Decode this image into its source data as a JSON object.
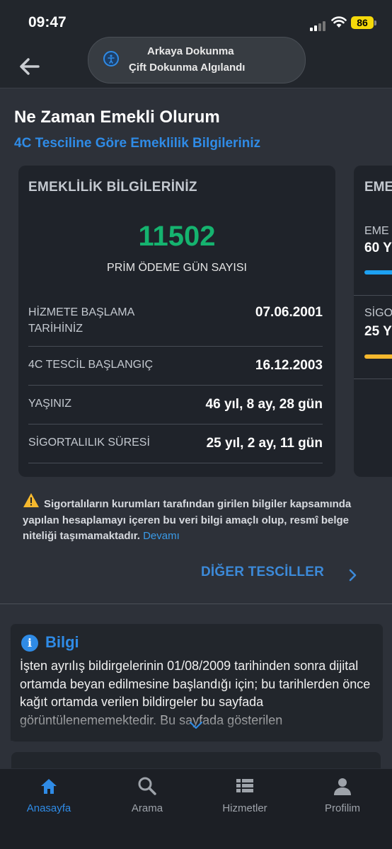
{
  "status": {
    "time": "09:47",
    "battery": "86"
  },
  "toast": {
    "line1": "Arkaya Dokunma",
    "line2": "Çift Dokunma Algılandı"
  },
  "page": {
    "title": "Ne Zaman Emekli Olurum",
    "subtitle": "4C Tesciline Göre Emeklilik Bilgileriniz"
  },
  "card": {
    "title": "EMEKLİLİK BİLGİLERİNİZ",
    "premium_days": "11502",
    "premium_days_label": "PRİM ÖDEME GÜN SAYISI",
    "rows": [
      {
        "label": "HİZMETE BAŞLAMA TARİHİNİZ",
        "value": "07.06.2001"
      },
      {
        "label": "4C TESCİL BAŞLANGIÇ",
        "value": "16.12.2003"
      },
      {
        "label": "YAŞINIZ",
        "value": "46 yıl, 8 ay, 28 gün"
      },
      {
        "label": "SİGORTALILIK SÜRESİ",
        "value": "25 yıl, 2 ay, 11 gün"
      }
    ]
  },
  "card2": {
    "title": "EME",
    "row1_label": "EME",
    "row1_value": "60 Y",
    "row2_label": "SİGO",
    "row2_value": "25 Y",
    "bar1_color": "#1da1f2",
    "bar2_color": "#f5b82e"
  },
  "warning": {
    "text": "Sigortalıların kurumları tarafından girilen bilgiler kapsamında yapılan hesaplamayı içeren bu veri bilgi amaçlı olup, resmî belge niteliği taşımamaktadır.",
    "link": "Devamı"
  },
  "other_registrations": "DİĞER TESCİLLER",
  "info": {
    "title": "Bilgi",
    "text": "İşten ayrılış bildirgelerinin 01/08/2009 tarihinden sonra dijital ortamda beyan edilmesine başlandığı için; bu tarihlerden önce kağıt ortamda verilen bildirgeler bu sayfada görüntülenememektedir. Bu sayfada gösterilen"
  },
  "tabs": [
    {
      "label": "Anasayfa",
      "icon": "home-icon",
      "active": true
    },
    {
      "label": "Arama",
      "icon": "search-icon",
      "active": false
    },
    {
      "label": "Hizmetler",
      "icon": "list-icon",
      "active": false
    },
    {
      "label": "Profilim",
      "icon": "person-icon",
      "active": false
    }
  ],
  "colors": {
    "accent": "#2f8be6",
    "success": "#15b36f",
    "background": "#2d3139",
    "card": "#1f232a"
  }
}
